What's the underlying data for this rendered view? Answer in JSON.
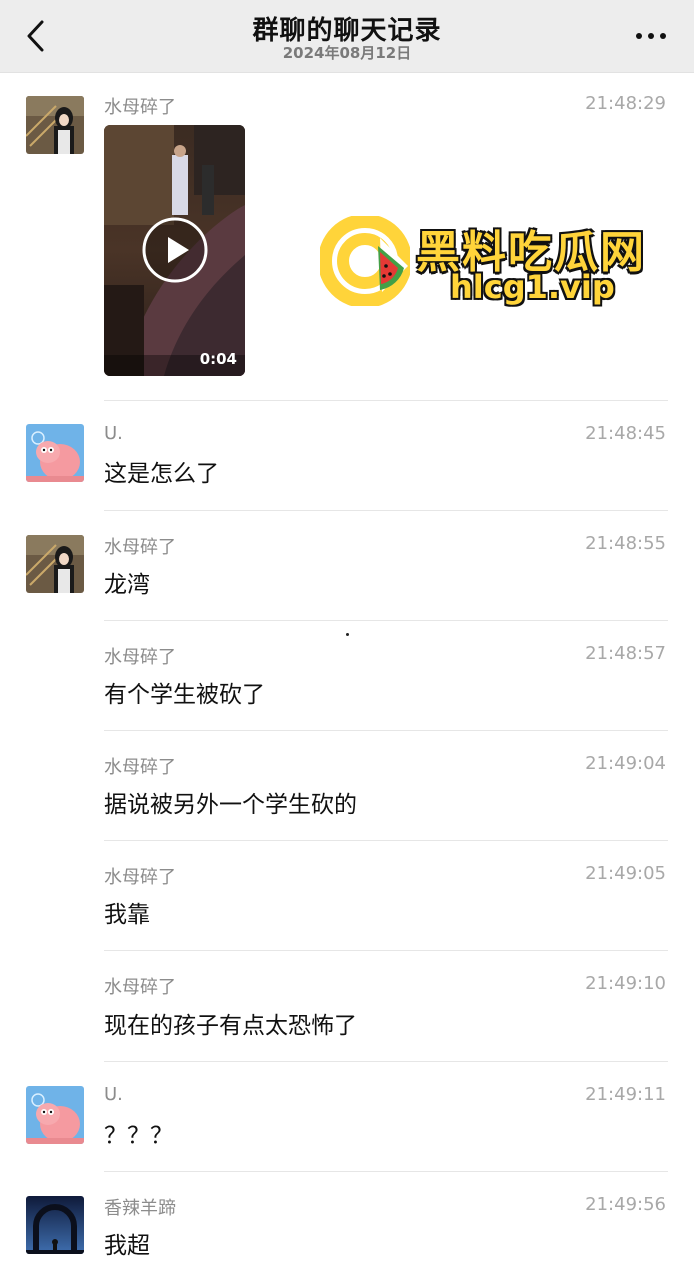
{
  "header": {
    "title": "群聊的聊天记录",
    "date": "2024年08月12日",
    "back_icon": "chevron-left-icon",
    "more_icon": "more-dots-icon"
  },
  "messages": [
    {
      "sender": "水母碎了",
      "time": "21:48:29",
      "type": "video",
      "video_duration": "0:04",
      "avatar": "girl-photo"
    },
    {
      "sender": "U.",
      "time": "21:48:45",
      "text": "这是怎么了",
      "avatar": "pink-cartoon"
    },
    {
      "sender": "水母碎了",
      "time": "21:48:55",
      "text": "龙湾",
      "avatar": "girl-photo"
    },
    {
      "sender": "水母碎了",
      "time": "21:48:57",
      "text": "有个学生被砍了"
    },
    {
      "sender": "水母碎了",
      "time": "21:49:04",
      "text": "据说被另外一个学生砍的"
    },
    {
      "sender": "水母碎了",
      "time": "21:49:05",
      "text": "我靠"
    },
    {
      "sender": "水母碎了",
      "time": "21:49:10",
      "text": "现在的孩子有点太恐怖了"
    },
    {
      "sender": "U.",
      "time": "21:49:11",
      "text": "？？？",
      "avatar": "pink-cartoon"
    },
    {
      "sender": "香辣羊蹄",
      "time": "21:49:56",
      "text": "我超",
      "avatar": "night-sky-photo"
    }
  ],
  "watermark": {
    "title": "黑料吃瓜网",
    "url": "hlcg1.vip",
    "colors": {
      "yellow": "#ffd43a",
      "outline": "#111111",
      "watermelon": "#e53935",
      "rind": "#43a047"
    }
  }
}
